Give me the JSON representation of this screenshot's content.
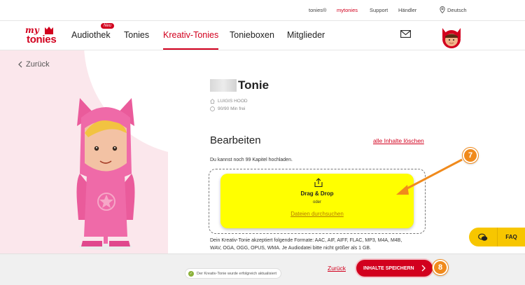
{
  "topbar": {
    "links": [
      "tonies®",
      "mytonies",
      "Support",
      "Händler"
    ],
    "active": "mytonies",
    "language": "Deutsch"
  },
  "nav": {
    "logo_my": "my",
    "logo_tonies": "tonies",
    "items": [
      "Audiothek",
      "Tonies",
      "Kreativ-Tonies",
      "Tonieboxen",
      "Mitglieder"
    ],
    "active": "Kreativ-Tonies",
    "badge": "Neu"
  },
  "back_label": "Zurück",
  "tonie": {
    "title": "Tonie",
    "owner": "LUIGIS HOOD",
    "capacity": "90/90 Min frei"
  },
  "edit": {
    "heading": "Bearbeiten",
    "delete_all": "alle Inhalte löschen",
    "info": "Du kannst noch 99 Kapitel hochladen.",
    "drag_drop": "Drag & Drop",
    "or": "oder",
    "browse": "Dateien durchsuchen",
    "formats_line1": "Dein Kreativ-Tonie akzeptiert folgende Formate: AAC, AIF, AIFF, FLAC, MP3, M4A, M4B,",
    "formats_line2": "WAV, OGA, OGG, OPUS, WMA. Je Audiodatei bitte nicht größer als 1 GB."
  },
  "annotations": {
    "step7": "7",
    "step8": "8"
  },
  "faq_label": "FAQ",
  "bottom": {
    "toast": "Der Kreativ-Tonie wurde erfolgreich aktualisiert",
    "back": "Zurück",
    "save": "INHALTE SPEICHERN"
  },
  "colors": {
    "brand": "#d2001e",
    "highlight": "#ffff00",
    "annotation": "#f08a1c",
    "faq": "#f7c600"
  }
}
